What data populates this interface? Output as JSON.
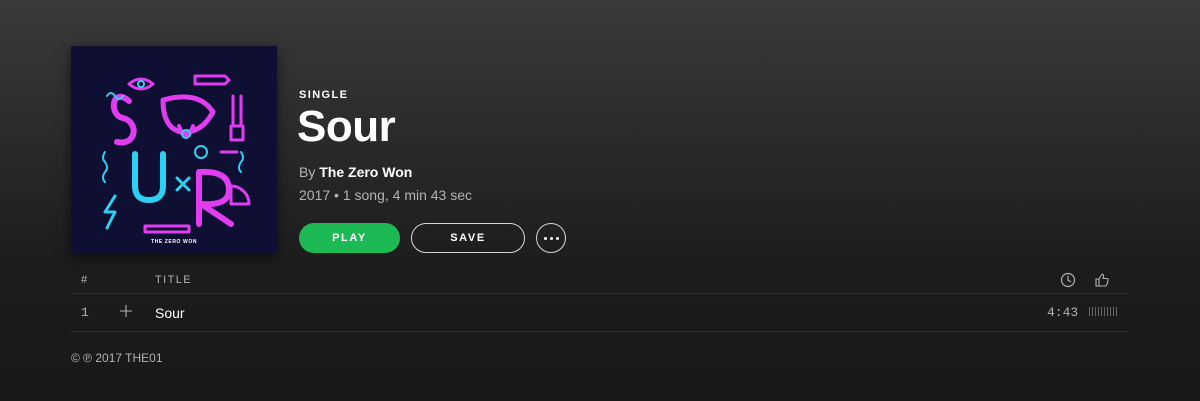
{
  "album": {
    "type_label": "SINGLE",
    "title": "Sour",
    "by_prefix": "By",
    "artist": "The Zero Won",
    "meta": "2017 • 1 song, 4 min 43 sec",
    "cover_caption": "THE ZERO WON"
  },
  "actions": {
    "play_label": "PLAY",
    "save_label": "SAVE",
    "more_icon": "ellipsis-icon"
  },
  "tracklist": {
    "headers": {
      "number": "#",
      "title": "TITLE",
      "duration_icon": "clock-icon",
      "like_icon": "thumbs-up-icon"
    },
    "tracks": [
      {
        "number": "1",
        "title": "Sour",
        "duration": "4:43"
      }
    ]
  },
  "footer": {
    "copyright": "© ℗ 2017 THE01"
  },
  "colors": {
    "accent": "#1db954",
    "neon_pink": "#e03cf0",
    "neon_cyan": "#2ed0f2"
  }
}
